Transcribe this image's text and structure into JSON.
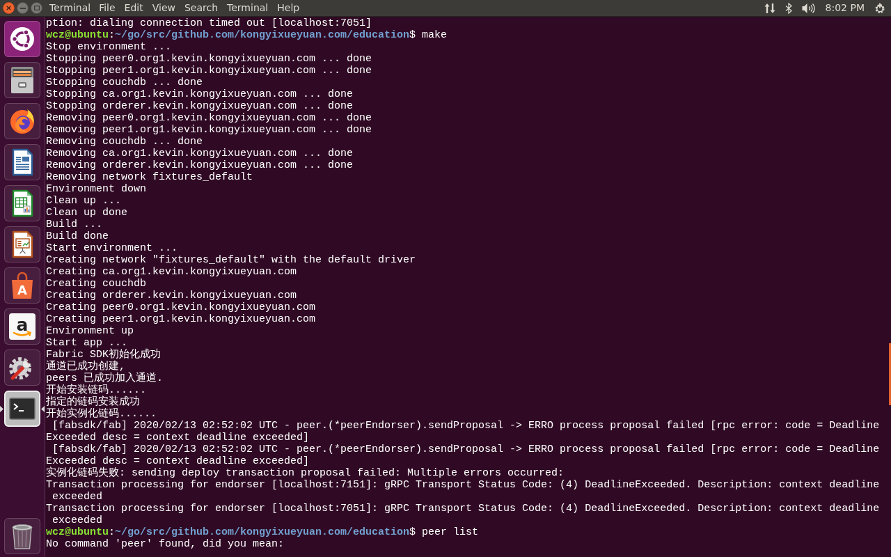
{
  "menu_bar": {
    "title": "Terminal",
    "menus": [
      "File",
      "Edit",
      "View",
      "Search",
      "Terminal",
      "Help"
    ],
    "clock": "8:02 PM"
  },
  "launcher": {
    "items": [
      {
        "kind": "home",
        "running": false,
        "selected": false
      },
      {
        "kind": "files",
        "running": false,
        "selected": false
      },
      {
        "kind": "browser",
        "running": false,
        "selected": false
      },
      {
        "kind": "writer",
        "running": false,
        "selected": false
      },
      {
        "kind": "calc",
        "running": false,
        "selected": false
      },
      {
        "kind": "impress",
        "running": false,
        "selected": false
      },
      {
        "kind": "store",
        "glyph": "A",
        "running": false,
        "selected": false
      },
      {
        "kind": "shop",
        "glyph": "a",
        "running": false,
        "selected": false
      },
      {
        "kind": "settings",
        "running": false,
        "selected": false
      },
      {
        "kind": "terminal",
        "running": true,
        "selected": true
      }
    ],
    "bottom_items": [
      {
        "kind": "trash",
        "running": false,
        "selected": false
      }
    ]
  },
  "terminal": {
    "lines": [
      {
        "kind": "output",
        "text": "ption: dialing connection timed out [localhost:7051]"
      },
      {
        "kind": "prompt",
        "segments": [
          {
            "kind": "user",
            "text": "wcz@ubuntu"
          },
          {
            "kind": "plain",
            "text": ":"
          },
          {
            "kind": "path",
            "text": "~/go/src/github.com/kongyixueyuan.com/education"
          },
          {
            "kind": "plain",
            "text": "$ make"
          }
        ]
      },
      {
        "kind": "output",
        "text": "Stop environment ..."
      },
      {
        "kind": "output",
        "text": "Stopping peer0.org1.kevin.kongyixueyuan.com ... done"
      },
      {
        "kind": "output",
        "text": "Stopping peer1.org1.kevin.kongyixueyuan.com ... done"
      },
      {
        "kind": "output",
        "text": "Stopping couchdb ... done"
      },
      {
        "kind": "output",
        "text": "Stopping ca.org1.kevin.kongyixueyuan.com ... done"
      },
      {
        "kind": "output",
        "text": "Stopping orderer.kevin.kongyixueyuan.com ... done"
      },
      {
        "kind": "output",
        "text": "Removing peer0.org1.kevin.kongyixueyuan.com ... done"
      },
      {
        "kind": "output",
        "text": "Removing peer1.org1.kevin.kongyixueyuan.com ... done"
      },
      {
        "kind": "output",
        "text": "Removing couchdb ... done"
      },
      {
        "kind": "output",
        "text": "Removing ca.org1.kevin.kongyixueyuan.com ... done"
      },
      {
        "kind": "output",
        "text": "Removing orderer.kevin.kongyixueyuan.com ... done"
      },
      {
        "kind": "output",
        "text": "Removing network fixtures_default"
      },
      {
        "kind": "output",
        "text": "Environment down"
      },
      {
        "kind": "output",
        "text": "Clean up ..."
      },
      {
        "kind": "output",
        "text": "Clean up done"
      },
      {
        "kind": "output",
        "text": "Build ..."
      },
      {
        "kind": "output",
        "text": "Build done"
      },
      {
        "kind": "output",
        "text": "Start environment ..."
      },
      {
        "kind": "output",
        "text": "Creating network \"fixtures_default\" with the default driver"
      },
      {
        "kind": "output",
        "text": "Creating ca.org1.kevin.kongyixueyuan.com"
      },
      {
        "kind": "output",
        "text": "Creating couchdb"
      },
      {
        "kind": "output",
        "text": "Creating orderer.kevin.kongyixueyuan.com"
      },
      {
        "kind": "output",
        "text": "Creating peer0.org1.kevin.kongyixueyuan.com"
      },
      {
        "kind": "output",
        "text": "Creating peer1.org1.kevin.kongyixueyuan.com"
      },
      {
        "kind": "output",
        "text": "Environment up"
      },
      {
        "kind": "output",
        "text": "Start app ..."
      },
      {
        "kind": "output",
        "text": "Fabric SDK初始化成功"
      },
      {
        "kind": "output",
        "text": "通道已成功创建,"
      },
      {
        "kind": "output",
        "text": "peers 已成功加入通道."
      },
      {
        "kind": "output",
        "text": "开始安装链码......"
      },
      {
        "kind": "output",
        "text": "指定的链码安装成功"
      },
      {
        "kind": "output",
        "text": "开始实例化链码......"
      },
      {
        "kind": "output",
        "text": " [fabsdk/fab] 2020/02/13 02:52:02 UTC - peer.(*peerEndorser).sendProposal -> ERRO process proposal failed [rpc error: code = Deadline"
      },
      {
        "kind": "output",
        "text": "Exceeded desc = context deadline exceeded]"
      },
      {
        "kind": "output",
        "text": " [fabsdk/fab] 2020/02/13 02:52:02 UTC - peer.(*peerEndorser).sendProposal -> ERRO process proposal failed [rpc error: code = Deadline"
      },
      {
        "kind": "output",
        "text": "Exceeded desc = context deadline exceeded]"
      },
      {
        "kind": "output",
        "text": "实例化链码失败: sending deploy transaction proposal failed: Multiple errors occurred:"
      },
      {
        "kind": "output",
        "text": "Transaction processing for endorser [localhost:7151]: gRPC Transport Status Code: (4) DeadlineExceeded. Description: context deadline"
      },
      {
        "kind": "output",
        "text": " exceeded"
      },
      {
        "kind": "output",
        "text": "Transaction processing for endorser [localhost:7051]: gRPC Transport Status Code: (4) DeadlineExceeded. Description: context deadline"
      },
      {
        "kind": "output",
        "text": " exceeded"
      },
      {
        "kind": "prompt",
        "segments": [
          {
            "kind": "user",
            "text": "wcz@ubuntu"
          },
          {
            "kind": "plain",
            "text": ":"
          },
          {
            "kind": "path",
            "text": "~/go/src/github.com/kongyixueyuan.com/education"
          },
          {
            "kind": "plain",
            "text": "$ peer list"
          }
        ]
      },
      {
        "kind": "output",
        "text": "No command 'peer' found, did you mean:"
      }
    ]
  }
}
